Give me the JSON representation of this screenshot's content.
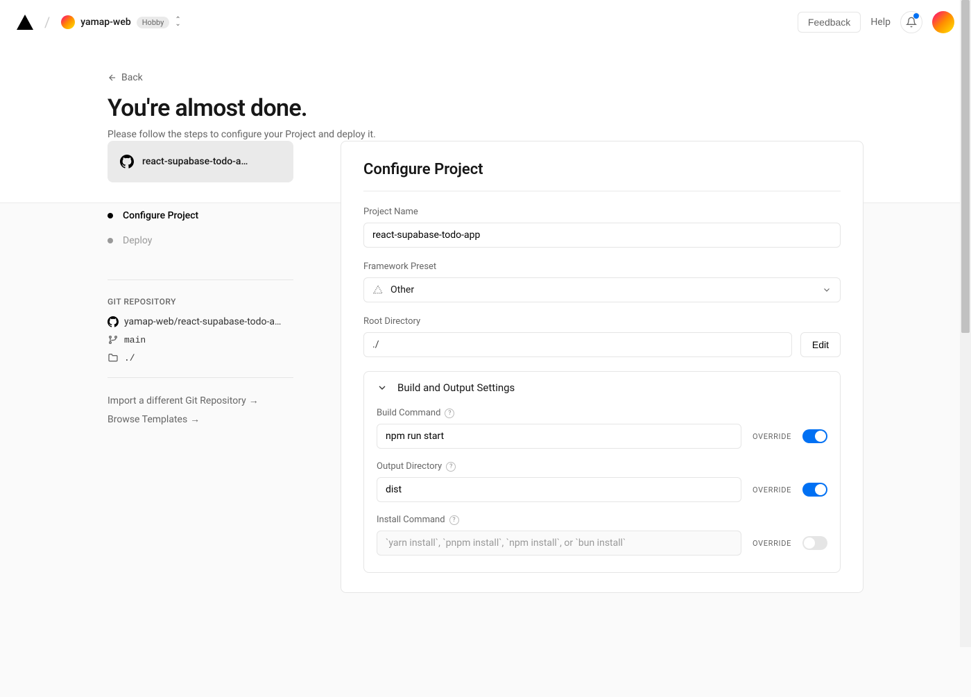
{
  "header": {
    "scope_name": "yamap-web",
    "plan_badge": "Hobby",
    "feedback_label": "Feedback",
    "help_label": "Help"
  },
  "page": {
    "back_label": "Back",
    "title": "You're almost done.",
    "subtitle": "Please follow the steps to configure your Project and deploy it."
  },
  "sidebar": {
    "repo_short": "react-supabase-todo-a…",
    "steps": [
      {
        "label": "Configure Project",
        "active": true
      },
      {
        "label": "Deploy",
        "active": false
      }
    ],
    "git_section_label": "GIT REPOSITORY",
    "repo_full": "yamap-web/react-supabase-todo-a…",
    "branch": "main",
    "root_path": "./",
    "import_link": "Import a different Git Repository",
    "browse_link": "Browse Templates"
  },
  "card": {
    "title": "Configure Project",
    "project_name_label": "Project Name",
    "project_name_value": "react-supabase-todo-app",
    "framework_label": "Framework Preset",
    "framework_value": "Other",
    "root_dir_label": "Root Directory",
    "root_dir_value": "./",
    "edit_label": "Edit",
    "build_section_label": "Build and Output Settings",
    "override_label": "OVERRIDE",
    "build_command": {
      "label": "Build Command",
      "value": "npm run start",
      "override": true
    },
    "output_directory": {
      "label": "Output Directory",
      "value": "dist",
      "override": true
    },
    "install_command": {
      "label": "Install Command",
      "placeholder": "`yarn install`, `pnpm install`, `npm install`, or `bun install`",
      "override": false
    }
  }
}
